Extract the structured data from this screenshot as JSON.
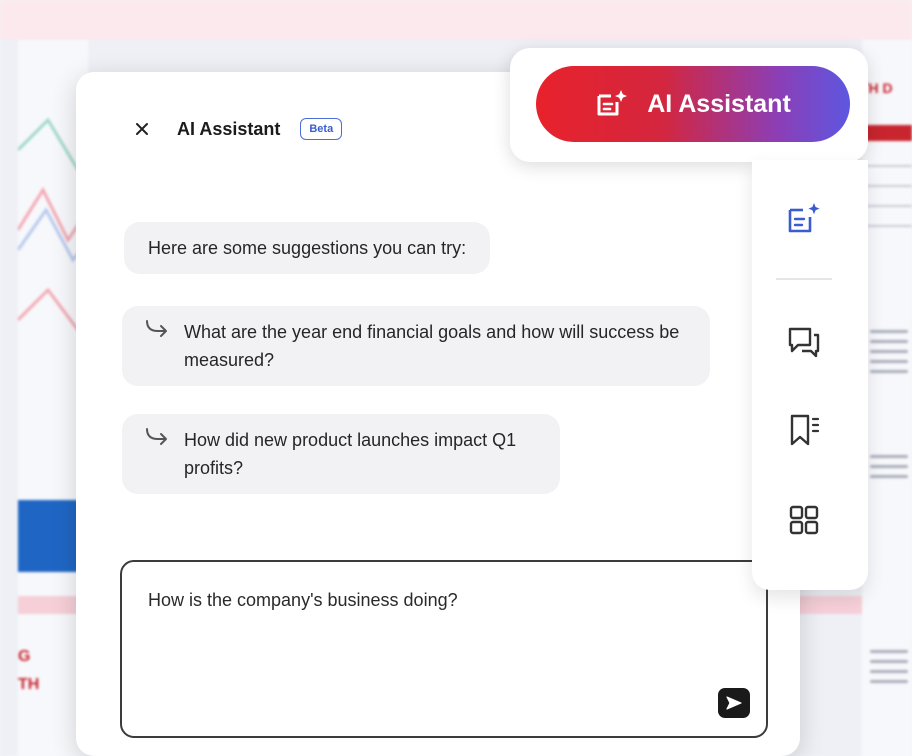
{
  "background_doc": {
    "right_title_fragment": "TH D",
    "left_heading_fragment_1": "G",
    "left_heading_fragment_2": "TH"
  },
  "assistant_panel": {
    "title": "AI Assistant",
    "badge": "Beta",
    "intro": "Here are some suggestions you can try:",
    "suggestions": [
      {
        "text": "What are the year end financial goals and how will success be measured?"
      },
      {
        "text": "How did new product launches impact Q1 profits?"
      }
    ],
    "input_value": "How is the company's business doing?"
  },
  "assistant_button": {
    "label": "AI Assistant"
  },
  "icons": {
    "close": "close-icon",
    "suggestion_arrow": "arrow-return-icon",
    "send": "send-icon",
    "ai": "ai-sparkle-icon",
    "toolbar": [
      "ai-assistant-icon",
      "comment-icon",
      "bookmark-icon",
      "grid-icon"
    ]
  },
  "colors": {
    "pill_gradient_start": "#e8222c",
    "pill_gradient_end": "#5d57e0",
    "beta_badge": "#3a5ccc"
  }
}
